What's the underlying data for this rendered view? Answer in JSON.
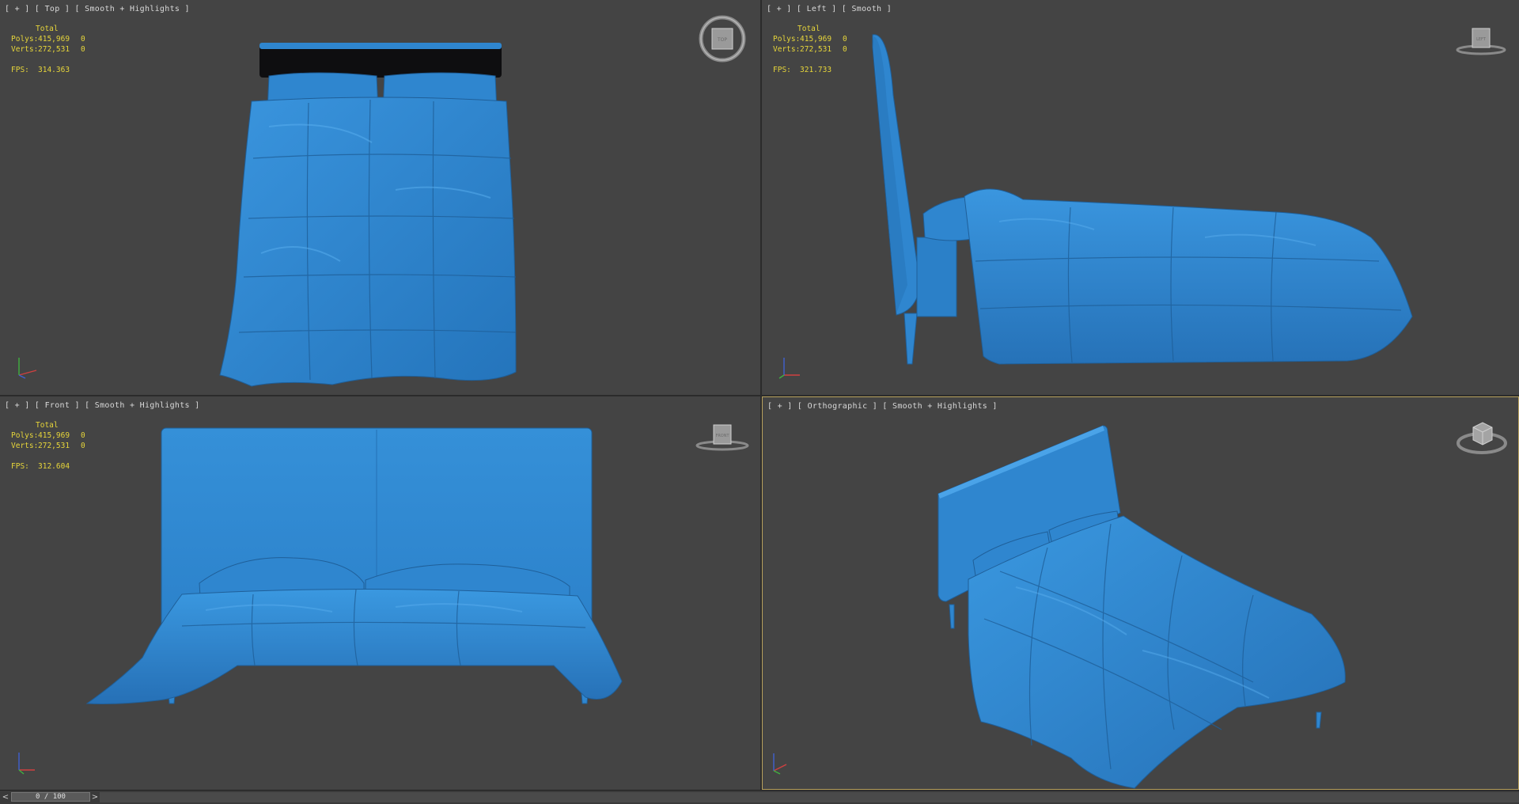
{
  "viewports": {
    "top": {
      "label": "[ + ] [ Top ] [ Smooth + Highlights ]",
      "total": "Total",
      "polys_key": "Polys:",
      "polys_val": "415,969",
      "polys_sel": "0",
      "verts_key": "Verts:",
      "verts_val": "272,531",
      "verts_sel": "0",
      "fps_key": "FPS:",
      "fps_val": "314.363",
      "viewcube_face": "TOP"
    },
    "left": {
      "label": "[ + ] [ Left ] [ Smooth ]",
      "total": "Total",
      "polys_key": "Polys:",
      "polys_val": "415,969",
      "polys_sel": "0",
      "verts_key": "Verts:",
      "verts_val": "272,531",
      "verts_sel": "0",
      "fps_key": "FPS:",
      "fps_val": "321.733",
      "viewcube_face": "LEFT"
    },
    "front": {
      "label": "[ + ] [ Front ] [ Smooth + Highlights ]",
      "total": "Total",
      "polys_key": "Polys:",
      "polys_val": "415,969",
      "polys_sel": "0",
      "verts_key": "Verts:",
      "verts_val": "272,531",
      "verts_sel": "0",
      "fps_key": "FPS:",
      "fps_val": "312.604",
      "viewcube_face": "FRONT"
    },
    "ortho": {
      "label": "[ + ] [ Orthographic ] [ Smooth + Highlights ]"
    }
  },
  "timeline": {
    "prev": "<",
    "frame": "0 / 100",
    "next": ">"
  },
  "colors": {
    "viewport_bg": "#444444",
    "model_blue": "#2f86cf",
    "stats_yellow": "#e6d53a",
    "active_border": "#b9a25e"
  }
}
